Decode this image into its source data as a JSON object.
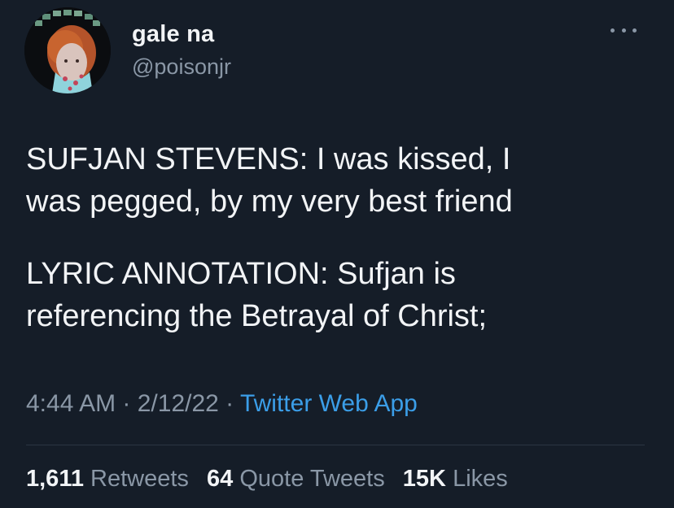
{
  "author": {
    "display_name": "gale na",
    "handle": "@poisonjr"
  },
  "tweet": {
    "paragraph_1": "SUFJAN STEVENS: I was kissed, I\nwas pegged, by my very best friend",
    "paragraph_2": "LYRIC ANNOTATION: Sufjan is\nreferencing the Betrayal of Christ;"
  },
  "meta": {
    "time": "4:44 AM",
    "date": "2/12/22",
    "separator": " · ",
    "source": "Twitter Web App"
  },
  "stats": {
    "retweets_count": "1,611",
    "retweets_label": "Retweets",
    "quotes_count": "64",
    "quotes_label": "Quote Tweets",
    "likes_count": "15K",
    "likes_label": "Likes"
  },
  "icons": {
    "more": "more-options-icon",
    "avatar": "profile-avatar"
  },
  "colors": {
    "background": "#151d28",
    "text_primary": "#f2f4f6",
    "text_secondary": "#8a97a6",
    "link": "#3b9ee8"
  }
}
